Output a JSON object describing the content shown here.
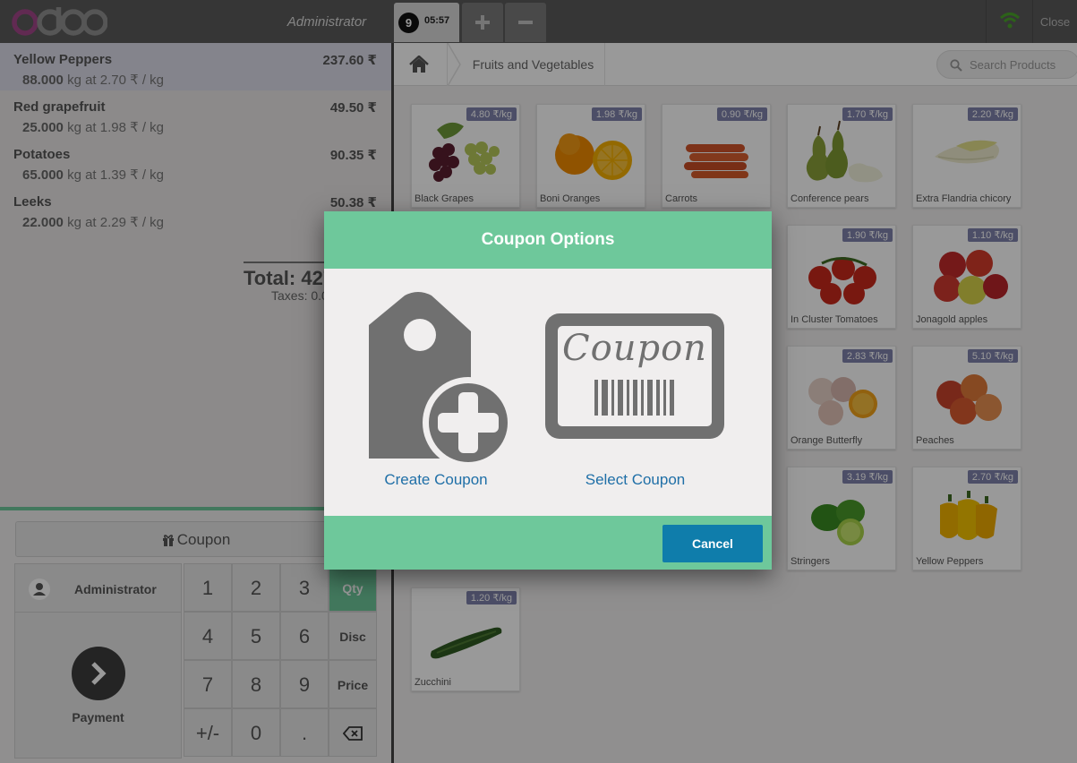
{
  "header": {
    "logo_text": "odoo",
    "cashier": "Administrator",
    "order_number": "9",
    "order_time": "05:57",
    "add_order_icon": "plus-icon",
    "delete_order_icon": "minus-icon",
    "wifi_icon": "wifi-icon",
    "close_label": "Close"
  },
  "order": {
    "lines": [
      {
        "name": "Yellow Peppers",
        "qty": "88.000",
        "unit_info": "kg at 2.70 ₹ / kg",
        "price": "237.60 ₹",
        "selected": true
      },
      {
        "name": "Red grapefruit",
        "qty": "25.000",
        "unit_info": "kg at 1.98 ₹ / kg",
        "price": "49.50 ₹",
        "selected": false
      },
      {
        "name": "Potatoes",
        "qty": "65.000",
        "unit_info": "kg at 1.39 ₹ / kg",
        "price": "90.35 ₹",
        "selected": false
      },
      {
        "name": "Leeks",
        "qty": "22.000",
        "unit_info": "kg at 2.29 ₹ / kg",
        "price": "50.38 ₹",
        "selected": false
      }
    ],
    "total_label": "Total: 427",
    "taxes_label": "Taxes: 0.0"
  },
  "coupon_button": {
    "label": "Coupon",
    "icon": "gift-icon"
  },
  "pad": {
    "customer_label": "Administrator",
    "customer_icon": "user-icon",
    "payment_label": "Payment",
    "payment_icon": "chevron-right-icon",
    "keys": [
      "1",
      "2",
      "3",
      "4",
      "5",
      "6",
      "7",
      "8",
      "9",
      "+/-",
      "0",
      "."
    ],
    "modes": [
      "Qty",
      "Disc",
      "Price"
    ],
    "active_mode": "Qty",
    "backspace_icon": "backspace-icon"
  },
  "products_header": {
    "home_icon": "home-icon",
    "category": "Fruits and Vegetables",
    "search_placeholder": "Search Products"
  },
  "products": [
    {
      "name": "Black Grapes",
      "price": "4.80 ₹/kg",
      "icon": "grapes-icon"
    },
    {
      "name": "Boni Oranges",
      "price": "1.98 ₹/kg",
      "icon": "orange-icon"
    },
    {
      "name": "Carrots",
      "price": "0.90 ₹/kg",
      "icon": "carrot-icon"
    },
    {
      "name": "Conference pears",
      "price": "1.70 ₹/kg",
      "icon": "pear-icon"
    },
    {
      "name": "Extra Flandria chicory",
      "price": "2.20 ₹/kg",
      "icon": "chicory-icon"
    },
    {
      "name": "In Cluster Tomatoes",
      "price": "1.90 ₹/kg",
      "icon": "tomato-icon"
    },
    {
      "name": "Jonagold apples",
      "price": "1.10 ₹/kg",
      "icon": "apple-icon"
    },
    {
      "name": "Orange Butterfly",
      "price": "2.83 ₹/kg",
      "icon": "orange-butterfly-icon"
    },
    {
      "name": "Peaches",
      "price": "5.10 ₹/kg",
      "icon": "peach-icon"
    },
    {
      "name": "Stringers",
      "price": "3.19 ₹/kg",
      "icon": "lime-icon"
    },
    {
      "name": "Yellow Peppers",
      "price": "2.70 ₹/kg",
      "icon": "pepper-icon"
    },
    {
      "name": "Zucchini",
      "price": "1.20 ₹/kg",
      "icon": "zucchini-icon"
    }
  ],
  "modal": {
    "title": "Coupon Options",
    "create_label": "Create Coupon",
    "create_icon": "tag-plus-icon",
    "select_label": "Select Coupon",
    "select_icon": "coupon-barcode-icon",
    "coupon_card_text": "Coupon",
    "cancel_label": "Cancel"
  },
  "colors": {
    "accent": "#6ec89b",
    "button_blue": "#0f7dab",
    "link_blue": "#1f6fa7",
    "price_tag": "#7f82ac",
    "header_dark": "#5a5a5a"
  }
}
